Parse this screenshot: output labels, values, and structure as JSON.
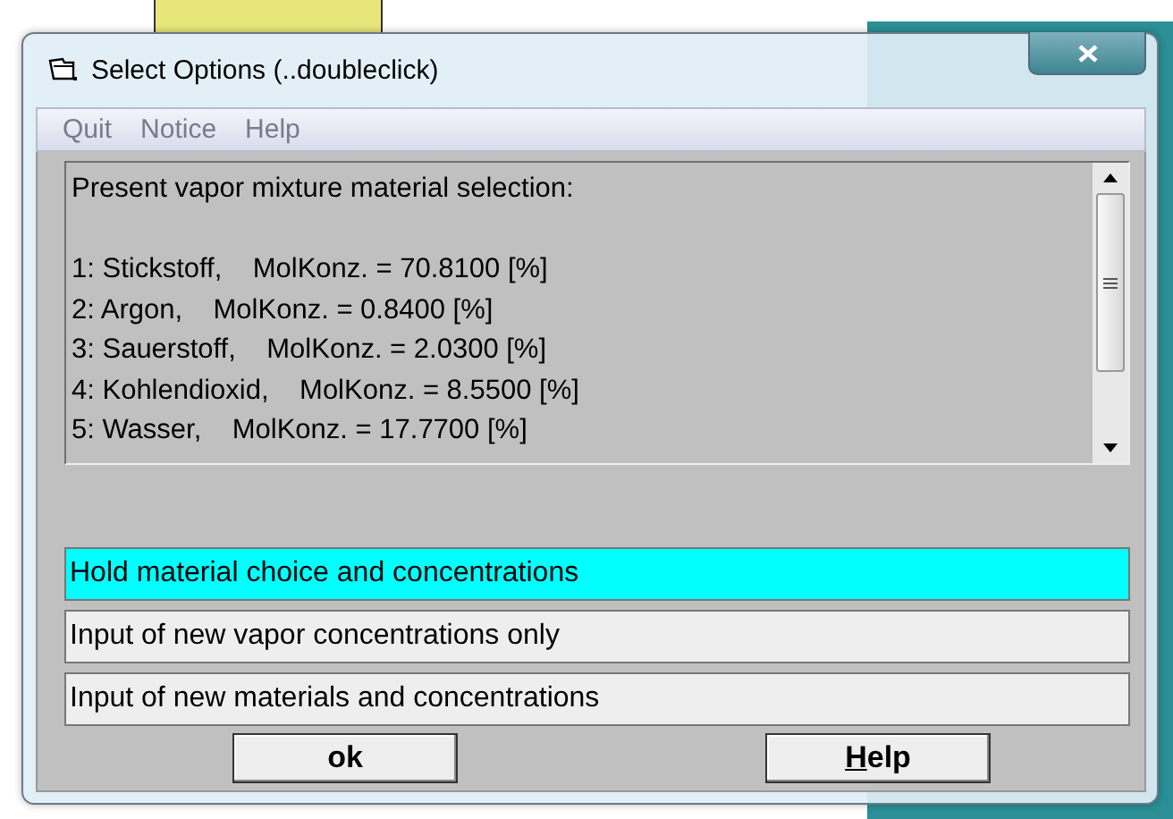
{
  "window": {
    "title": "Select Options (..doubleclick)"
  },
  "menu": [
    "Quit",
    "Notice",
    "Help"
  ],
  "info_heading": "Present vapor mixture material selection:",
  "info_lines": [
    "1: Stickstoff,    MolKonz. = 70.8100 [%]",
    "2: Argon,    MolKonz. = 0.8400 [%]",
    "3: Sauerstoff,    MolKonz. = 2.0300 [%]",
    "4: Kohlendioxid,    MolKonz. = 8.5500 [%]",
    "5: Wasser,    MolKonz. = 17.7700 [%]"
  ],
  "options": [
    {
      "label": "Hold material choice and concentrations",
      "selected": true
    },
    {
      "label": "Input of new vapor concentrations only",
      "selected": false
    },
    {
      "label": "Input of new materials and concentrations",
      "selected": false
    }
  ],
  "buttons": [
    {
      "label": "ok",
      "mnemonic_underlined": false
    },
    {
      "label": "Help",
      "mnemonic_underlined": true
    }
  ]
}
